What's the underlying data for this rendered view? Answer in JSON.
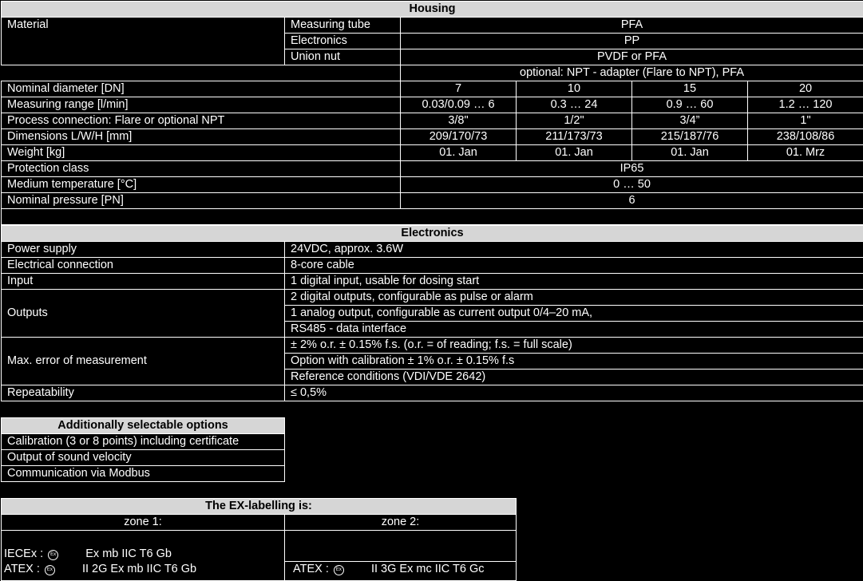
{
  "housing": {
    "title": "Housing",
    "material_label": "Material",
    "materials": [
      {
        "part": "Measuring tube",
        "value": "PFA"
      },
      {
        "part": "Electronics",
        "value": "PP"
      },
      {
        "part": "Union nut",
        "value": "PVDF or PFA"
      }
    ],
    "optional_note": "optional: NPT - adapter (Flare to NPT), PFA",
    "rows": [
      {
        "label": "Nominal diameter [DN]",
        "values": [
          "7",
          "10",
          "15",
          "20"
        ]
      },
      {
        "label": "Measuring range [l/min]",
        "values": [
          "0.03/0.09 … 6",
          "0.3 … 24",
          "0.9 … 60",
          "1.2 … 120"
        ]
      },
      {
        "label": "Process connection: Flare or optional NPT",
        "values": [
          "3/8\"",
          "1/2\"",
          "3/4”",
          "1\""
        ]
      },
      {
        "label": "Dimensions L/W/H [mm]",
        "values": [
          "209/170/73",
          "211/173/73",
          "215/187/76",
          "238/108/86"
        ]
      },
      {
        "label": "Weight [kg]",
        "values": [
          "01. Jan",
          "01. Jan",
          "01. Jan",
          "01. Mrz"
        ]
      }
    ],
    "single_rows": [
      {
        "label": "Protection class",
        "value": "IP65"
      },
      {
        "label": "Medium temperature [°C]",
        "value": "0 … 50"
      },
      {
        "label": "Nominal pressure [PN]",
        "value": "6"
      }
    ]
  },
  "electronics": {
    "title": "Electronics",
    "power_label": "Power supply",
    "power_value": "24VDC, approx. 3.6W",
    "connection_label": "Electrical connection",
    "connection_value": "8-core cable",
    "input_label": "Input",
    "input_value": "1 digital input, usable for dosing start",
    "outputs_label": "Outputs",
    "outputs_values": [
      "2 digital outputs, configurable as pulse or alarm",
      "1 analog output, configurable as current output 0/4–20 mA,",
      "RS485 - data interface"
    ],
    "error_label": "Max. error of measurement",
    "error_values": [
      "± 2% o.r. ± 0.15% f.s. (o.r. = of reading; f.s. = full scale)",
      "Option with calibration ± 1% o.r. ± 0.15% f.s",
      "Reference conditions (VDI/VDE 2642)"
    ],
    "repeat_label": "Repeatability",
    "repeat_value": "≤ 0,5%"
  },
  "options": {
    "title": "Additionally selectable options",
    "items": [
      "Calibration (3 or 8 points) including certificate",
      "Output of sound velocity",
      "Communication via Modbus"
    ]
  },
  "ex": {
    "title": "The EX-labelling is:",
    "zone1_label": "zone 1:",
    "zone2_label": "zone 2:",
    "symbol": "Ex",
    "iecex_prefix": "IECEx :",
    "iecex_value": "Ex mb IIC T6 Gb",
    "atex1_prefix": "ATEX :",
    "atex1_value": "II 2G Ex mb IIC T6 Gb",
    "atex2_prefix": "ATEX :",
    "atex2_value": "II 3G Ex mc IIC T6 Gc"
  }
}
